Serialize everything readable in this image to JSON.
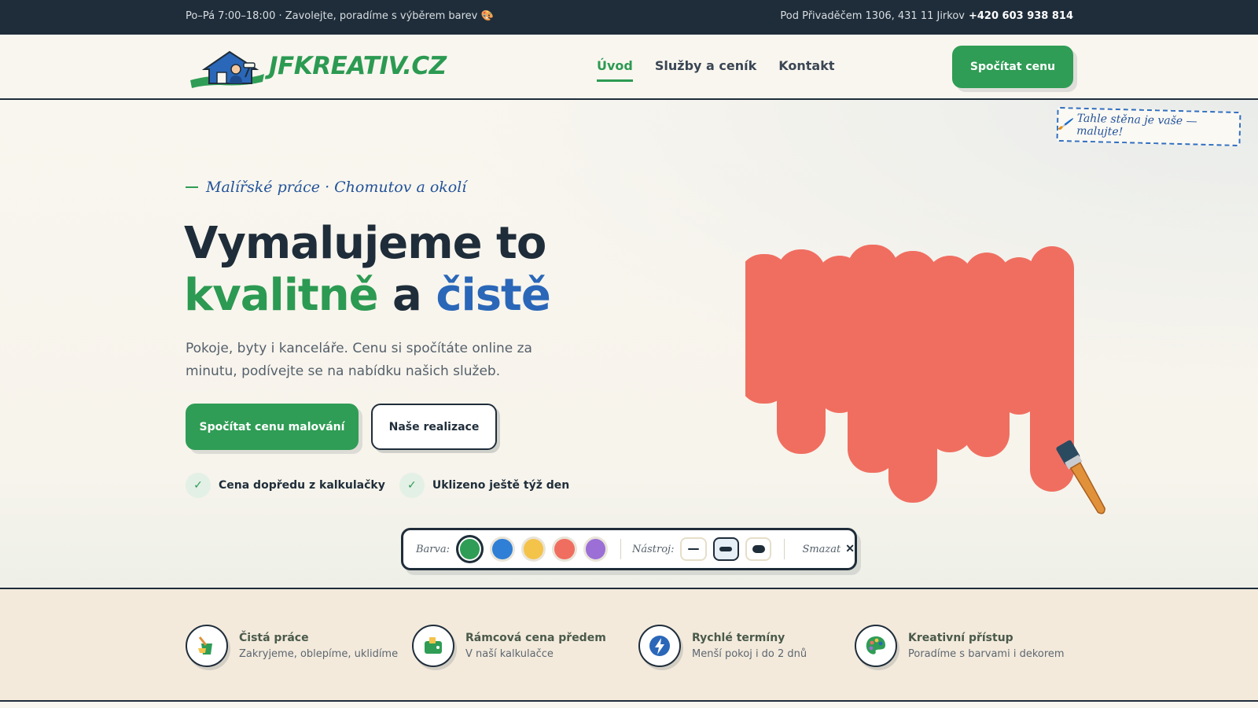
{
  "topbar": {
    "hours": "Po–Pá 7:00–18:00 · Zavolejte, poradíme s výběrem barev 🎨",
    "address": "Pod Přivaděčem 1306, 431 11 Jirkov",
    "phone": "+420 603 938 814"
  },
  "nav": {
    "logo_text": "JFKREATIV.CZ",
    "items": [
      {
        "label": "Úvod",
        "active": true
      },
      {
        "label": "Služby a ceník",
        "active": false
      },
      {
        "label": "Kontakt",
        "active": false
      }
    ],
    "cta": "Spočítat cenu"
  },
  "hero": {
    "sticker": "Tahle stěna je vaše — malujte!",
    "sticker_icon": "paintbrush-icon",
    "kicker": "Malířské práce · Chomutov a okolí",
    "title_line1": "Vymalujeme to",
    "title_green": "kvalitně",
    "title_and": " a ",
    "title_blue": "čistě",
    "lead": "Pokoje, byty i kanceláře. Cenu si spočítáte online za minutu, podívejte se na nabídku našich služeb.",
    "btn_primary": "Spočítat cenu malování",
    "btn_secondary": "Naše realizace",
    "checks": [
      "Cena dopředu z kalkulačky",
      "Uklizeno ještě týž den"
    ],
    "check_mark": "✓",
    "paint_color": "#f06e60"
  },
  "toolbar": {
    "color_label": "Barva:",
    "colors": [
      {
        "hex": "#2f9d55",
        "selected": true
      },
      {
        "hex": "#2f7fd6",
        "selected": false
      },
      {
        "hex": "#f4c34a",
        "selected": false
      },
      {
        "hex": "#f06e60",
        "selected": false
      },
      {
        "hex": "#9b6fd6",
        "selected": false
      }
    ],
    "tool_label": "Nástroj:",
    "tools": [
      {
        "name": "thin-brush",
        "selected": false
      },
      {
        "name": "medium-brush",
        "selected": true
      },
      {
        "name": "thick-brush",
        "selected": false
      }
    ],
    "clear_label": "Smazat",
    "clear_icon": "✕"
  },
  "features": [
    {
      "icon": "bucket-icon",
      "title": "Čistá práce",
      "subtitle": "Zakryjeme, oblepíme, uklidíme"
    },
    {
      "icon": "wallet-icon",
      "title": "Rámcová cena předem",
      "subtitle": "V naší kalkulačce"
    },
    {
      "icon": "lightning-icon",
      "title": "Rychlé termíny",
      "subtitle": "Menší pokoj i do 2 dnů"
    },
    {
      "icon": "palette-icon",
      "title": "Kreativní přístup",
      "subtitle": "Poradíme s barvami i dekorem"
    }
  ],
  "colors": {
    "dark": "#1f2d3a",
    "green": "#2c9a52",
    "blue": "#2a67b8",
    "cream": "#f9f6ef",
    "strip": "#f3eadc"
  }
}
